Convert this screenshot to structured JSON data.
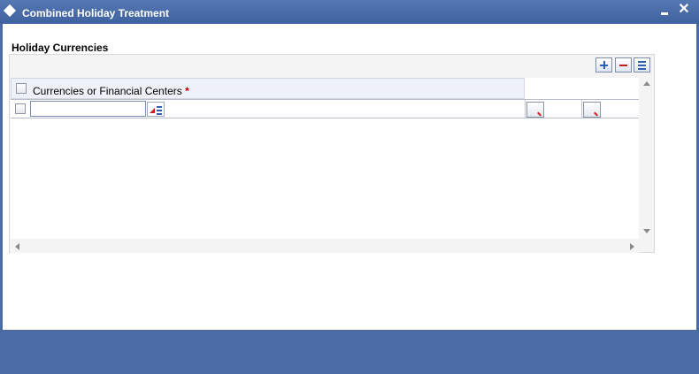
{
  "window": {
    "title": "Combined Holiday Treatment",
    "close_glyph": "✕"
  },
  "section": {
    "title": "Holiday Currencies"
  },
  "grid": {
    "toolbar": [
      "add-row",
      "delete-row",
      "single-view"
    ],
    "columns": [
      {
        "label": "Currencies or Financial Centers",
        "required_marker": "*"
      }
    ],
    "rows": [
      {
        "checked": false,
        "value": ""
      }
    ]
  },
  "colors": {
    "title_bar": "#4a6ba3",
    "footer": "#4a6ba3",
    "required": "#c00000"
  }
}
